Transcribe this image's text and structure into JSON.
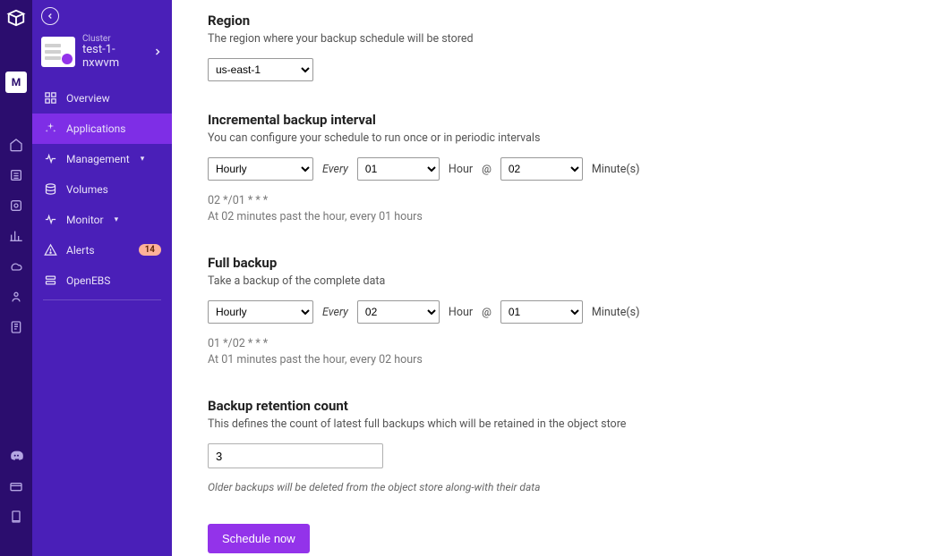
{
  "rail": {
    "active_letter": "M"
  },
  "sidebar": {
    "cluster_label": "Cluster",
    "cluster_name_line1": "test-1-",
    "cluster_name_line2": "nxwvm",
    "items": [
      {
        "label": "Overview"
      },
      {
        "label": "Applications"
      },
      {
        "label": "Management"
      },
      {
        "label": "Volumes"
      },
      {
        "label": "Monitor"
      },
      {
        "label": "Alerts",
        "badge": "14"
      },
      {
        "label": "OpenEBS"
      }
    ]
  },
  "region": {
    "title": "Region",
    "desc": "The region where your backup schedule will be stored",
    "value": "us-east-1"
  },
  "incremental": {
    "title": "Incremental backup interval",
    "desc": "You can configure your schedule to run once or in periodic intervals",
    "freq": "Hourly",
    "every_label": "Every",
    "hour_val": "01",
    "hour_label": "Hour",
    "at_label": "@",
    "minute_val": "02",
    "minute_label": "Minute(s)",
    "cron": "02 */01 * * *",
    "cron_desc": "At 02 minutes past the hour, every 01 hours"
  },
  "full": {
    "title": "Full backup",
    "desc": "Take a backup of the complete data",
    "freq": "Hourly",
    "every_label": "Every",
    "hour_val": "02",
    "hour_label": "Hour",
    "at_label": "@",
    "minute_val": "01",
    "minute_label": "Minute(s)",
    "cron": "01 */02 * * *",
    "cron_desc": "At 01 minutes past the hour, every 02 hours"
  },
  "retention": {
    "title": "Backup retention count",
    "desc": "This defines the count of latest full backups which will be retained in the object store",
    "value": "3",
    "hint": "Older backups will be deleted from the object store along-with their data"
  },
  "submit_label": "Schedule now"
}
